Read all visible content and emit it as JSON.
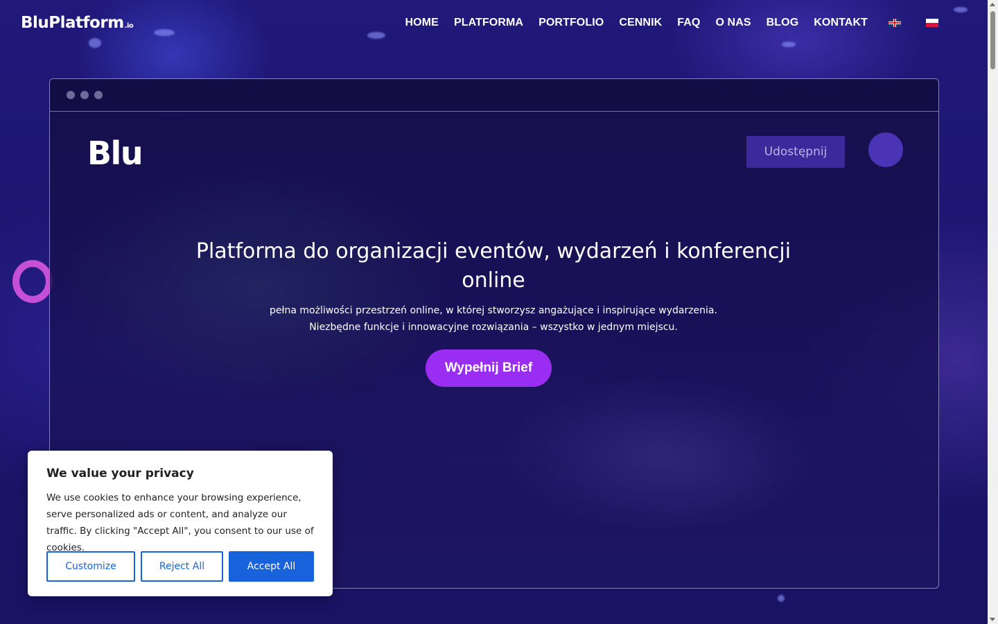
{
  "header": {
    "logo_main": "BluPlatform",
    "logo_suffix": ".io",
    "nav": [
      {
        "label": "HOME"
      },
      {
        "label": "PLATFORMA"
      },
      {
        "label": "PORTFOLIO"
      },
      {
        "label": "CENNIK"
      },
      {
        "label": "FAQ"
      },
      {
        "label": "O NAS"
      },
      {
        "label": "BLOG"
      },
      {
        "label": "KONTAKT"
      }
    ],
    "languages": [
      {
        "code": "en",
        "icon": "uk-flag-icon"
      },
      {
        "code": "pl",
        "icon": "poland-flag-icon"
      }
    ]
  },
  "mockup": {
    "logo": "Blu",
    "share_label": "Udostępnij",
    "title": "Platforma do organizacji eventów, wydarzeń i konferencji online",
    "subtitle_line1": "pełna możliwości przestrzeń online, w której stworzysz angażujące i inspirujące wydarzenia.",
    "subtitle_line2": "Niezbędne funkcje i innowacyjne rozwiązania – wszystko w jednym miejscu.",
    "cta_label": "Wypełnij Brief"
  },
  "cookie_banner": {
    "title": "We value your privacy",
    "text": "We use cookies to enhance your browsing experience, serve personalized ads or content, and analyze our traffic. By clicking \"Accept All\", you consent to our use of cookies.",
    "customize_label": "Customize",
    "reject_label": "Reject All",
    "accept_label": "Accept All"
  },
  "colors": {
    "accent_purple": "#9a2df2",
    "cookie_blue": "#1863dc",
    "background": "#1d1768"
  }
}
